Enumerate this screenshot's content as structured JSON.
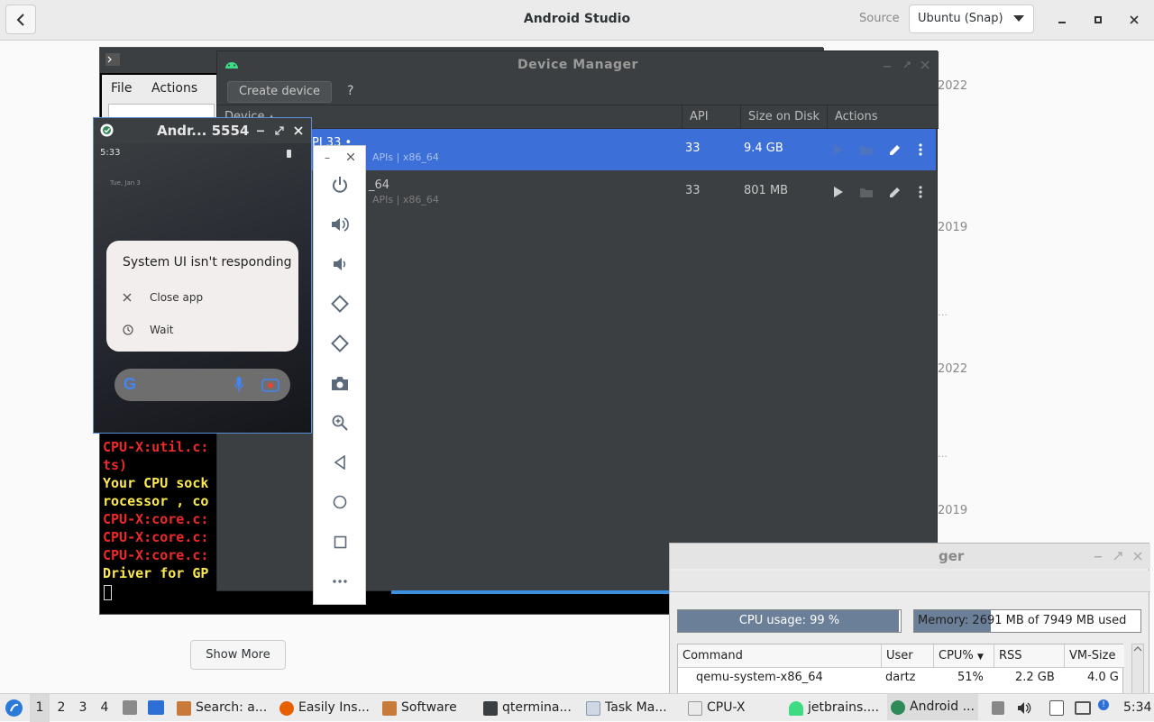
{
  "software_center": {
    "title": "Android Studio",
    "source_label": "Source",
    "source_value": "Ubuntu (Snap)",
    "side_dates": [
      "2022",
      "2019",
      "2022",
      "2019"
    ],
    "show_more": "Show More"
  },
  "terminal": {
    "menu": [
      "File",
      "Actions"
    ],
    "lines": [
      {
        "text": "CPU-X:util.c:",
        "color": "red"
      },
      {
        "text": "ts)",
        "color": "red"
      },
      {
        "text": "Your CPU sock",
        "color": "yellow"
      },
      {
        "text": "rocessor , co",
        "color": "yellow"
      },
      {
        "text": "CPU-X:core.c:",
        "color": "red"
      },
      {
        "text": "CPU-X:core.c:",
        "color": "red"
      },
      {
        "text": "CPU-X:core.c:",
        "color": "red"
      },
      {
        "text": "Driver for GP",
        "color": "yellow"
      }
    ]
  },
  "device_manager": {
    "title": "Device Manager",
    "create_device": "Create device",
    "help": "?",
    "columns": {
      "device": "Device",
      "api": "API",
      "size": "Size on Disk",
      "actions": "Actions"
    },
    "rows": [
      {
        "name": "PI 33 •",
        "sub": "APIs | x86_64",
        "api": "33",
        "size": "9.4 GB",
        "selected": true
      },
      {
        "name": "_64",
        "sub": "APIs | x86_64",
        "api": "33",
        "size": "801 MB",
        "selected": false
      }
    ]
  },
  "emulator": {
    "title": "Andr... 5554",
    "time": "5:33",
    "wallpaper_text": "Tue, Jan 3",
    "dialog_title": "System UI isn't responding",
    "options": [
      "Close app",
      "Wait"
    ]
  },
  "task_manager": {
    "title": "ger",
    "cpu_usage": "CPU usage: 99 %",
    "cpu_fraction": 0.99,
    "memory": "Memory: 2691 MB of 7949 MB used",
    "memory_fraction": 0.34,
    "columns": [
      "Command",
      "User",
      "CPU%",
      "RSS",
      "VM-Size"
    ],
    "row": {
      "command": "qemu-system-x86_64",
      "user": "dartz",
      "cpu": "51%",
      "rss": "2.2 GB",
      "vm": "4.0 G"
    }
  },
  "taskbar": {
    "workspaces": [
      "1",
      "2",
      "3",
      "4"
    ],
    "items": [
      "Search: a...",
      "Easily Ins...",
      "Software",
      "qtermina...",
      "Task Ma...",
      "CPU-X",
      "jetbrains....",
      "Android ..."
    ],
    "clock": "5:34"
  },
  "colors": {
    "selection": "#3d6fd8",
    "dm_bg": "#3c3f41",
    "accent": "#5b8fd6"
  }
}
